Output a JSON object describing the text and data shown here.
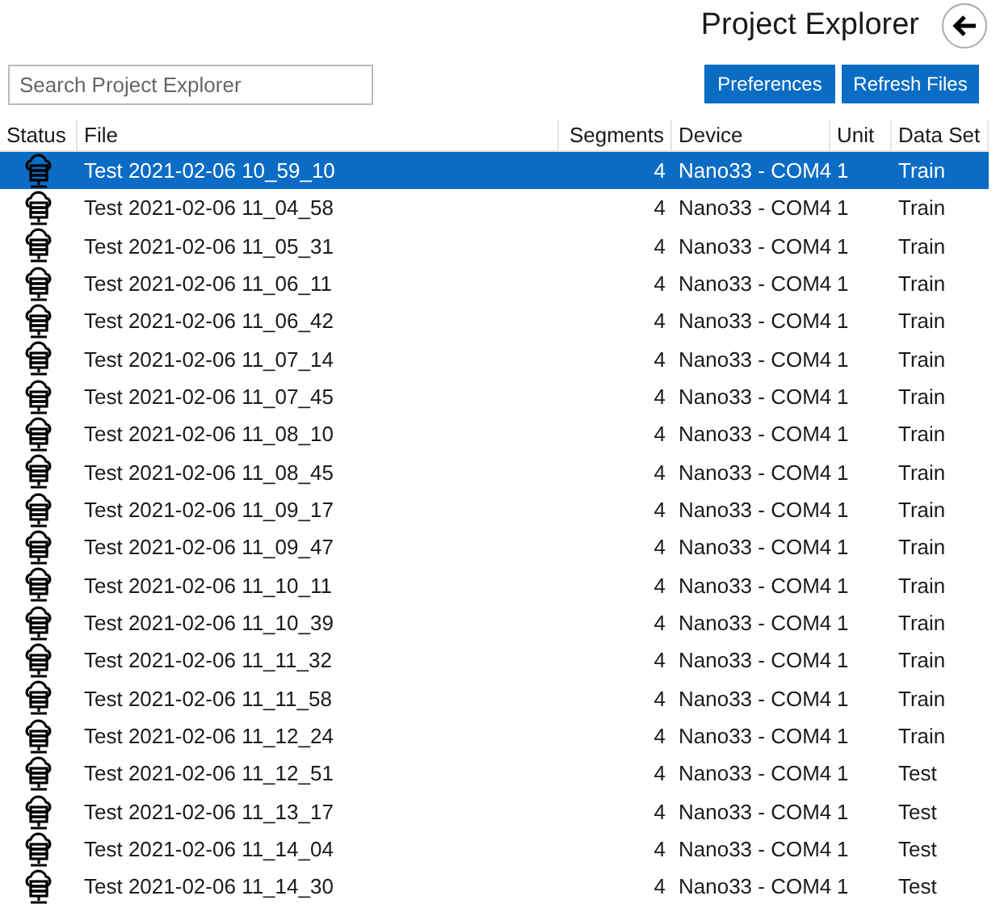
{
  "header": {
    "title": "Project Explorer"
  },
  "search": {
    "placeholder": "Search Project Explorer"
  },
  "buttons": [
    "Preferences",
    "Refresh Files"
  ],
  "table": {
    "columns": [
      "Status",
      "File",
      "Segments",
      "Device",
      "Unit",
      "Data Set"
    ],
    "rows": [
      {
        "file": "Test 2021-02-06 10_59_10",
        "segments": "4",
        "device": "Nano33 - COM4",
        "unit": "1",
        "data_set": "Train",
        "selected": true
      },
      {
        "file": "Test 2021-02-06 11_04_58",
        "segments": "4",
        "device": "Nano33 - COM4",
        "unit": "1",
        "data_set": "Train",
        "selected": false
      },
      {
        "file": "Test 2021-02-06 11_05_31",
        "segments": "4",
        "device": "Nano33 - COM4",
        "unit": "1",
        "data_set": "Train",
        "selected": false
      },
      {
        "file": "Test 2021-02-06 11_06_11",
        "segments": "4",
        "device": "Nano33 - COM4",
        "unit": "1",
        "data_set": "Train",
        "selected": false
      },
      {
        "file": "Test 2021-02-06 11_06_42",
        "segments": "4",
        "device": "Nano33 - COM4",
        "unit": "1",
        "data_set": "Train",
        "selected": false
      },
      {
        "file": "Test 2021-02-06 11_07_14",
        "segments": "4",
        "device": "Nano33 - COM4",
        "unit": "1",
        "data_set": "Train",
        "selected": false
      },
      {
        "file": "Test 2021-02-06 11_07_45",
        "segments": "4",
        "device": "Nano33 - COM4",
        "unit": "1",
        "data_set": "Train",
        "selected": false
      },
      {
        "file": "Test 2021-02-06 11_08_10",
        "segments": "4",
        "device": "Nano33 - COM4",
        "unit": "1",
        "data_set": "Train",
        "selected": false
      },
      {
        "file": "Test 2021-02-06 11_08_45",
        "segments": "4",
        "device": "Nano33 - COM4",
        "unit": "1",
        "data_set": "Train",
        "selected": false
      },
      {
        "file": "Test 2021-02-06 11_09_17",
        "segments": "4",
        "device": "Nano33 - COM4",
        "unit": "1",
        "data_set": "Train",
        "selected": false
      },
      {
        "file": "Test 2021-02-06 11_09_47",
        "segments": "4",
        "device": "Nano33 - COM4",
        "unit": "1",
        "data_set": "Train",
        "selected": false
      },
      {
        "file": "Test 2021-02-06 11_10_11",
        "segments": "4",
        "device": "Nano33 - COM4",
        "unit": "1",
        "data_set": "Train",
        "selected": false
      },
      {
        "file": "Test 2021-02-06 11_10_39",
        "segments": "4",
        "device": "Nano33 - COM4",
        "unit": "1",
        "data_set": "Train",
        "selected": false
      },
      {
        "file": "Test 2021-02-06 11_11_32",
        "segments": "4",
        "device": "Nano33 - COM4",
        "unit": "1",
        "data_set": "Train",
        "selected": false
      },
      {
        "file": "Test 2021-02-06 11_11_58",
        "segments": "4",
        "device": "Nano33 - COM4",
        "unit": "1",
        "data_set": "Train",
        "selected": false
      },
      {
        "file": "Test 2021-02-06 11_12_24",
        "segments": "4",
        "device": "Nano33 - COM4",
        "unit": "1",
        "data_set": "Train",
        "selected": false
      },
      {
        "file": "Test 2021-02-06 11_12_51",
        "segments": "4",
        "device": "Nano33 - COM4",
        "unit": "1",
        "data_set": "Test",
        "selected": false
      },
      {
        "file": "Test 2021-02-06 11_13_17",
        "segments": "4",
        "device": "Nano33 - COM4",
        "unit": "1",
        "data_set": "Test",
        "selected": false
      },
      {
        "file": "Test 2021-02-06 11_14_04",
        "segments": "4",
        "device": "Nano33 - COM4",
        "unit": "1",
        "data_set": "Test",
        "selected": false
      },
      {
        "file": "Test 2021-02-06 11_14_30",
        "segments": "4",
        "device": "Nano33 - COM4",
        "unit": "1",
        "data_set": "Test",
        "selected": false
      }
    ]
  }
}
